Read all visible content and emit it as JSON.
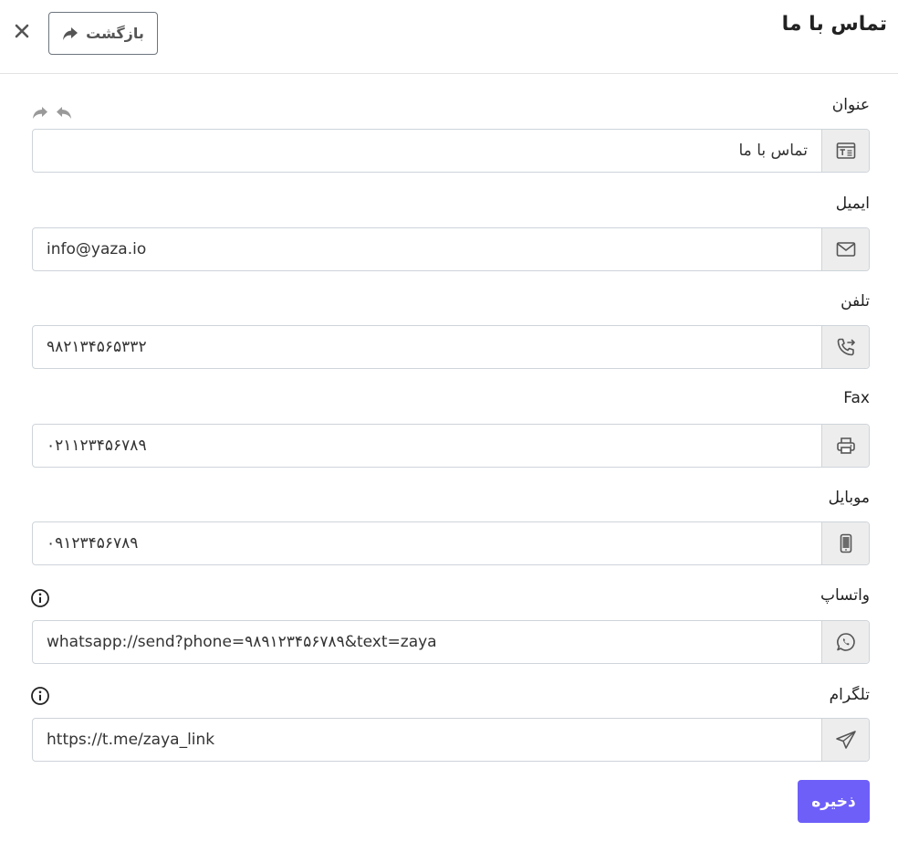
{
  "header": {
    "title": "تماس با ما",
    "back_label": "بازگشت",
    "back_icon": "share-arrow-icon",
    "close_icon": "close-icon"
  },
  "toolbar": {
    "undo_icon": "undo-icon",
    "redo_icon": "redo-icon"
  },
  "form": {
    "fields": [
      {
        "label": "عنوان",
        "value": "تماس با ما",
        "icon": "title-field-icon",
        "dir": "rtl"
      },
      {
        "label": "ایمیل",
        "value": "info@yaza.io",
        "icon": "envelope-icon",
        "dir": "ltr"
      },
      {
        "label": "تلفن",
        "value": "۹۸۲۱۳۴۵۶۵۳۳۲",
        "icon": "phone-forward-icon",
        "dir": "ltr"
      },
      {
        "label": "Fax",
        "value": "۰۲۱۱۲۳۴۵۶۷۸۹",
        "icon": "printer-icon",
        "dir": "ltr"
      },
      {
        "label": "موبایل",
        "value": "۰۹۱۲۳۴۵۶۷۸۹",
        "icon": "mobile-icon",
        "dir": "ltr"
      },
      {
        "label": "واتساپ",
        "value": "whatsapp://send?phone=۹۸۹۱۲۳۴۵۶۷۸۹&text=zaya",
        "icon": "whatsapp-icon",
        "dir": "ltr",
        "info": true
      },
      {
        "label": "تلگرام",
        "value": "https://t.me/zaya_link",
        "icon": "telegram-icon",
        "dir": "ltr",
        "info": true
      }
    ]
  },
  "actions": {
    "save_label": "ذخیره"
  },
  "colors": {
    "primary": "#6e5ff9",
    "addon_bg": "#ededed",
    "border": "#ced4da"
  }
}
